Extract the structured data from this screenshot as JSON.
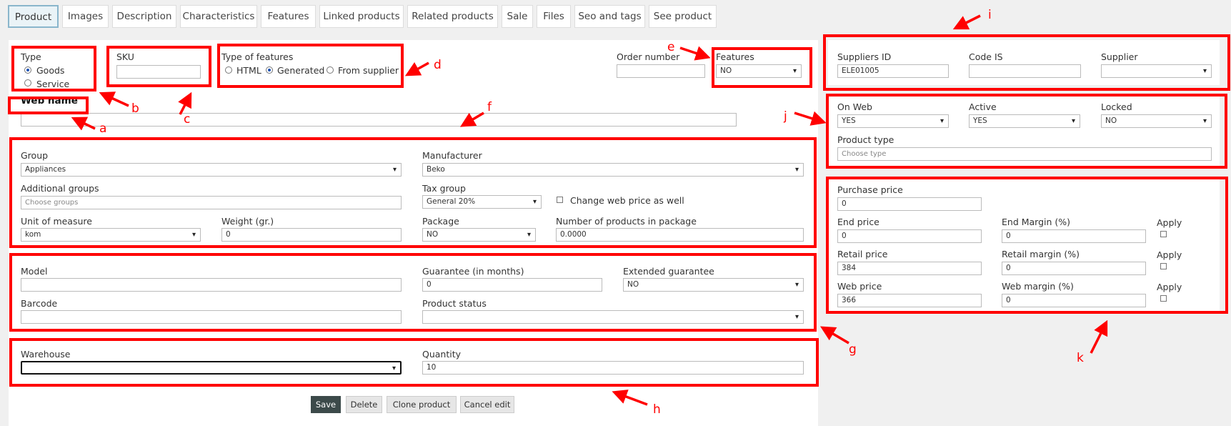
{
  "tabs": [
    {
      "label": "Product",
      "active": true
    },
    {
      "label": "Images"
    },
    {
      "label": "Description"
    },
    {
      "label": "Characteristics"
    },
    {
      "label": "Features"
    },
    {
      "label": "Linked products"
    },
    {
      "label": "Related products"
    },
    {
      "label": "Sale"
    },
    {
      "label": "Files"
    },
    {
      "label": "Seo and tags"
    },
    {
      "label": "See product"
    }
  ],
  "top": {
    "type_label": "Type",
    "type_options": [
      "Goods",
      "Service"
    ],
    "type_selected": "Goods",
    "sku_label": "SKU",
    "sku_value": "",
    "features_type_label": "Type of features",
    "features_type_options": [
      "HTML",
      "Generated",
      "From supplier"
    ],
    "features_type_selected": "Generated",
    "order_number_label": "Order number",
    "order_number_value": "",
    "features_label": "Features",
    "features_value": "NO",
    "web_name_label": "Web name",
    "web_name_value": ""
  },
  "general": {
    "group_label": "Group",
    "group_value": "Appliances",
    "manufacturer_label": "Manufacturer",
    "manufacturer_value": "Beko",
    "additional_groups_label": "Additional groups",
    "additional_groups_placeholder": "Choose groups",
    "tax_group_label": "Tax group",
    "tax_group_value": "General 20%",
    "change_web_price_label": "Change web price as well",
    "unit_label": "Unit of measure",
    "unit_value": "kom",
    "weight_label": "Weight (gr.)",
    "weight_value": "0",
    "package_label": "Package",
    "package_value": "NO",
    "num_in_package_label": "Number of products in package",
    "num_in_package_value": "0.0000"
  },
  "details": {
    "model_label": "Model",
    "model_value": "",
    "guarantee_label": "Guarantee (in months)",
    "guarantee_value": "0",
    "ext_guarantee_label": "Extended guarantee",
    "ext_guarantee_value": "NO",
    "barcode_label": "Barcode",
    "barcode_value": "",
    "status_label": "Product status",
    "status_value": ""
  },
  "stock": {
    "warehouse_label": "Warehouse",
    "warehouse_value": "",
    "quantity_label": "Quantity",
    "quantity_value": "10"
  },
  "supplier": {
    "suppliers_id_label": "Suppliers ID",
    "suppliers_id_value": "ELE01005",
    "code_is_label": "Code IS",
    "code_is_value": "",
    "supplier_label": "Supplier",
    "supplier_value": ""
  },
  "web": {
    "on_web_label": "On Web",
    "on_web_value": "YES",
    "active_label": "Active",
    "active_value": "YES",
    "locked_label": "Locked",
    "locked_value": "NO",
    "product_type_label": "Product type",
    "product_type_placeholder": "Choose type"
  },
  "prices": {
    "purchase_label": "Purchase price",
    "purchase_value": "0",
    "end_price_label": "End price",
    "end_price_value": "0",
    "end_margin_label": "End Margin (%)",
    "end_margin_value": "0",
    "retail_price_label": "Retail price",
    "retail_price_value": "384",
    "retail_margin_label": "Retail margin (%)",
    "retail_margin_value": "0",
    "web_price_label": "Web price",
    "web_price_value": "366",
    "web_margin_label": "Web margin (%)",
    "web_margin_value": "0",
    "apply_label": "Apply"
  },
  "buttons": {
    "save": "Save",
    "delete": "Delete",
    "clone": "Clone product",
    "cancel": "Cancel edit"
  },
  "annotations": {
    "a": "a",
    "b": "b",
    "c": "c",
    "d": "d",
    "e": "e",
    "f": "f",
    "g": "g",
    "h": "h",
    "i": "i",
    "j": "j",
    "k": "k"
  },
  "colors": {
    "highlight": "#ff0000",
    "active_tab_border": "#8ab6cc",
    "save_button": "#3c4a4a"
  }
}
